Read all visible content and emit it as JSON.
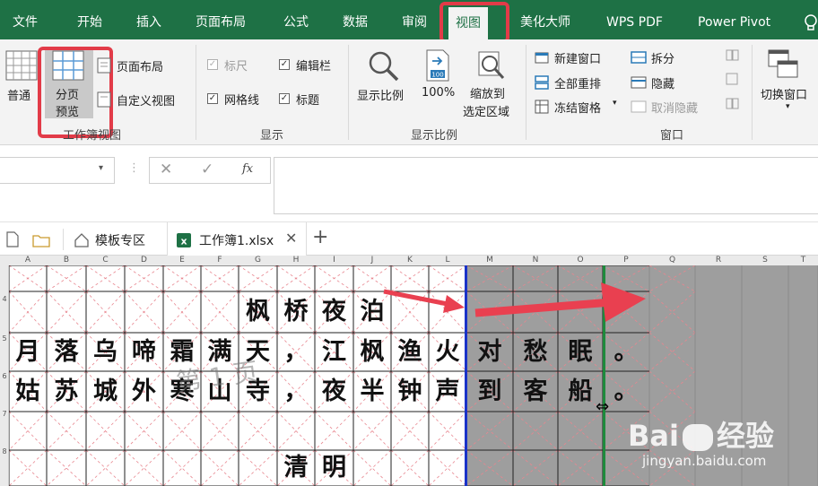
{
  "menubar": {
    "items": [
      "文件",
      "开始",
      "插入",
      "页面布局",
      "公式",
      "数据",
      "审阅",
      "视图",
      "美化大师",
      "WPS PDF",
      "Power Pivot"
    ],
    "active": "视图",
    "bg_color": "#1e7145",
    "highlight_color": "#e23b48"
  },
  "ribbon": {
    "workbook_views": {
      "normal": "普通",
      "page_break_line1": "分页",
      "page_break_line2": "预览",
      "page_layout": "页面布局",
      "custom_view": "自定义视图",
      "group_label": "工作簿视图"
    },
    "show": {
      "ruler": "标尺",
      "formula_bar": "编辑栏",
      "gridlines": "网格线",
      "headings": "标题",
      "group_label": "显示"
    },
    "zoom": {
      "zoom": "显示比例",
      "hundred": "100%",
      "zoom_sel_line1": "缩放到",
      "zoom_sel_line2": "选定区域",
      "group_label": "显示比例"
    },
    "window": {
      "new_window": "新建窗口",
      "arrange_all": "全部重排",
      "freeze": "冻结窗格",
      "split": "拆分",
      "hide": "隐藏",
      "unhide": "取消隐藏",
      "switch": "切换窗口",
      "group_label": "窗口"
    }
  },
  "formula": {
    "fx": "fx"
  },
  "tabs": {
    "templates": "模板专区",
    "workbook": "工作簿1.xlsx"
  },
  "grid": {
    "columns": [
      "A",
      "B",
      "C",
      "D",
      "E",
      "F",
      "G",
      "H",
      "I",
      "J",
      "K",
      "L",
      "M",
      "N",
      "O",
      "P",
      "Q",
      "R",
      "S",
      "T"
    ],
    "row_numbers": [
      "4",
      "5",
      "6",
      "7",
      "8"
    ],
    "title1": [
      "枫",
      "桥",
      "夜",
      "泊"
    ],
    "line1": [
      "月",
      "落",
      "乌",
      "啼",
      "霜",
      "满",
      "天",
      "，",
      "江",
      "枫",
      "渔",
      "火",
      "对",
      "愁",
      "眠",
      "。"
    ],
    "line2": [
      "姑",
      "苏",
      "城",
      "外",
      "寒",
      "山",
      "寺",
      "，",
      "夜",
      "半",
      "钟",
      "声",
      "到",
      "客",
      "船",
      "。"
    ],
    "title2": [
      "清",
      "明"
    ],
    "page_label": "第 1 页",
    "watermark_brand": "Bai",
    "watermark_brand2": "经验",
    "watermark_url": "jingyan.baidu.com"
  }
}
